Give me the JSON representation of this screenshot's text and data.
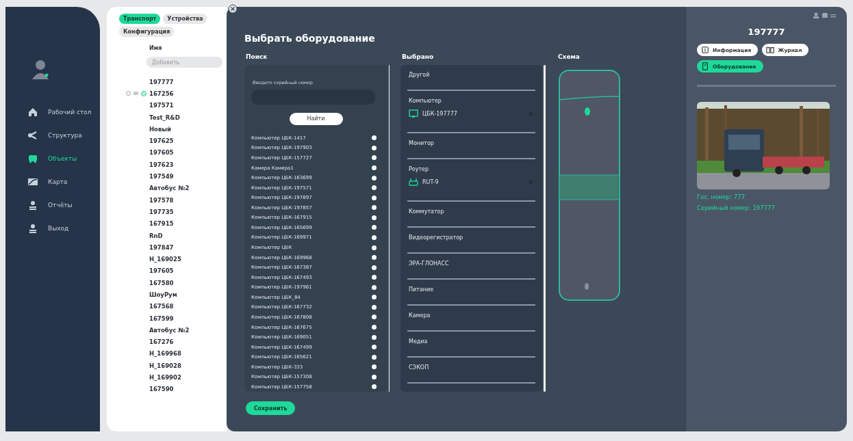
{
  "sidebar": {
    "items": [
      {
        "label": "Рабочий стол",
        "selected": false
      },
      {
        "label": "Структура",
        "selected": false
      },
      {
        "label": "Объекты",
        "selected": true
      },
      {
        "label": "Карта",
        "selected": false
      },
      {
        "label": "Отчёты",
        "selected": false
      },
      {
        "label": "Выход",
        "selected": false
      }
    ]
  },
  "tabs": [
    {
      "label": "Транспорт",
      "selected": true
    },
    {
      "label": "Устройства",
      "selected": false
    },
    {
      "label": "Конфигурация",
      "selected": false
    }
  ],
  "table": {
    "column": "Имя",
    "placeholder": "Добавить",
    "rows": [
      {
        "name": "197777",
        "hovered": false
      },
      {
        "name": "167256",
        "hovered": true
      },
      {
        "name": "197571",
        "hovered": false
      },
      {
        "name": "Test_R&D",
        "hovered": false
      },
      {
        "name": "Новый",
        "hovered": false
      },
      {
        "name": "197625",
        "hovered": false
      },
      {
        "name": "197605",
        "hovered": false
      },
      {
        "name": "197623",
        "hovered": false
      },
      {
        "name": "197549",
        "hovered": false
      },
      {
        "name": "Автобус №2",
        "hovered": false
      },
      {
        "name": "197578",
        "hovered": false
      },
      {
        "name": "197735",
        "hovered": false
      },
      {
        "name": "167915",
        "hovered": false
      },
      {
        "name": "RnD",
        "hovered": false
      },
      {
        "name": "197847",
        "hovered": false
      },
      {
        "name": "H_169025",
        "hovered": false
      },
      {
        "name": "197605",
        "hovered": false
      },
      {
        "name": "167580",
        "hovered": false
      },
      {
        "name": "ШоуРум",
        "hovered": false
      },
      {
        "name": "167568",
        "hovered": false
      },
      {
        "name": "167599",
        "hovered": false
      },
      {
        "name": "Автобус №2",
        "hovered": false
      },
      {
        "name": "167276",
        "hovered": false
      },
      {
        "name": "H_169968",
        "hovered": false
      },
      {
        "name": "H_169028",
        "hovered": false
      },
      {
        "name": "H_169902",
        "hovered": false
      },
      {
        "name": "167590",
        "hovered": false
      }
    ]
  },
  "modal": {
    "title": "Выбрать оборудование",
    "search": {
      "heading": "Поиск",
      "label": "Введите серийный номер",
      "button": "Найти",
      "results": [
        "Компьютер ЦБК-1417",
        "Компьютер ЦБК-197903",
        "Компьютер ЦБК-157727",
        "Камера Камера1",
        "Компьютер ЦБК-163699",
        "Компьютер ЦБК-197571",
        "Компьютер ЦБК-197897",
        "Компьютер ЦБК-197857",
        "Компьютер ЦБК-167915",
        "Компьютер ЦБК-165699",
        "Компьютер ЦБК-169971",
        "Компьютер ЦБК",
        "Компьютер ЦБК-169968",
        "Компьютер ЦБК-167387",
        "Компьютер ЦБК-167493",
        "Компьютер ЦБК-197961",
        "Компьютер ЦБК_84",
        "Компьютер ЦБК-167732",
        "Компьютер ЦБК-167808",
        "Компьютер ЦБК-167675",
        "Компьютер ЦБК-169051",
        "Компьютер ЦБК-167499",
        "Компьютер ЦБК-165621",
        "Компьютер ЦБК-333",
        "Компьютер ЦБК-157308",
        "Компьютер ЦБК-157758"
      ]
    },
    "selected": {
      "heading": "Выбрано",
      "groups": [
        {
          "name": "Другой"
        },
        {
          "name": "Компьютер",
          "devices": [
            {
              "kind": "computer",
              "label": "ЦБК-197777"
            }
          ]
        },
        {
          "name": "Монитор"
        },
        {
          "name": "Роутер",
          "devices": [
            {
              "kind": "router",
              "label": "RUT-9"
            }
          ]
        },
        {
          "name": "Коммутатор"
        },
        {
          "name": "Видеорегистратор"
        },
        {
          "name": "ЭРА-ГЛОНАСС"
        },
        {
          "name": "Питание"
        },
        {
          "name": "Камера"
        },
        {
          "name": "Медиа"
        },
        {
          "name": "СЭКОП"
        }
      ]
    },
    "scheme": {
      "heading": "Схема"
    },
    "save": "Сохранить"
  },
  "details": {
    "title": "197777",
    "buttons": [
      {
        "label": "Информация",
        "selected": false
      },
      {
        "label": "Журнал",
        "selected": false
      },
      {
        "label": "Оборудование",
        "selected": true
      }
    ],
    "fields": [
      "Гос. номер: 777",
      "Серийный номер: 197777"
    ]
  }
}
